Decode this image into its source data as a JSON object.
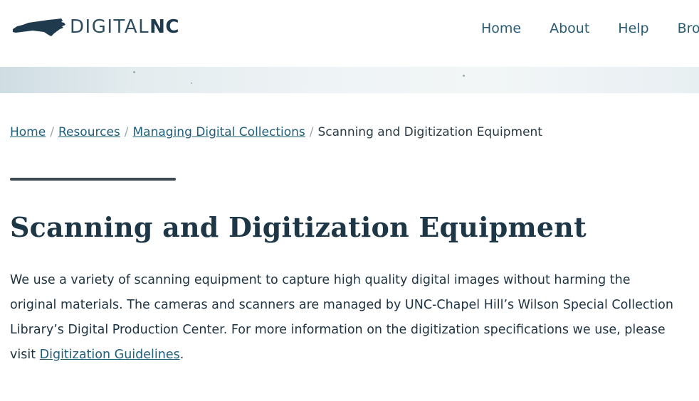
{
  "header": {
    "logo": {
      "text_light": "DIGITAL",
      "text_bold": "NC"
    },
    "nav": [
      {
        "label": "Home"
      },
      {
        "label": "About"
      },
      {
        "label": "Help"
      },
      {
        "label": "Bro"
      }
    ]
  },
  "breadcrumb": {
    "items": [
      {
        "label": "Home"
      },
      {
        "label": "Resources"
      },
      {
        "label": "Managing Digital Collections"
      }
    ],
    "separator": "/",
    "current": "Scanning and Digitization Equipment"
  },
  "page": {
    "title": "Scanning and Digitization Equipment",
    "intro_before_link": "We use a variety of scanning equipment to capture high quality digital images without harming the original materials. The cameras and scanners are managed by UNC-Chapel Hill’s Wilson Special Collection Library’s Digital Production Center.  For more information on the digitization specifications we use, please visit ",
    "intro_link": "Digitization Guidelines",
    "intro_after_link": "."
  },
  "colors": {
    "brand_dark": "#1e3a4c",
    "link": "#1f5f7a",
    "nav_link": "#2a5c74"
  }
}
